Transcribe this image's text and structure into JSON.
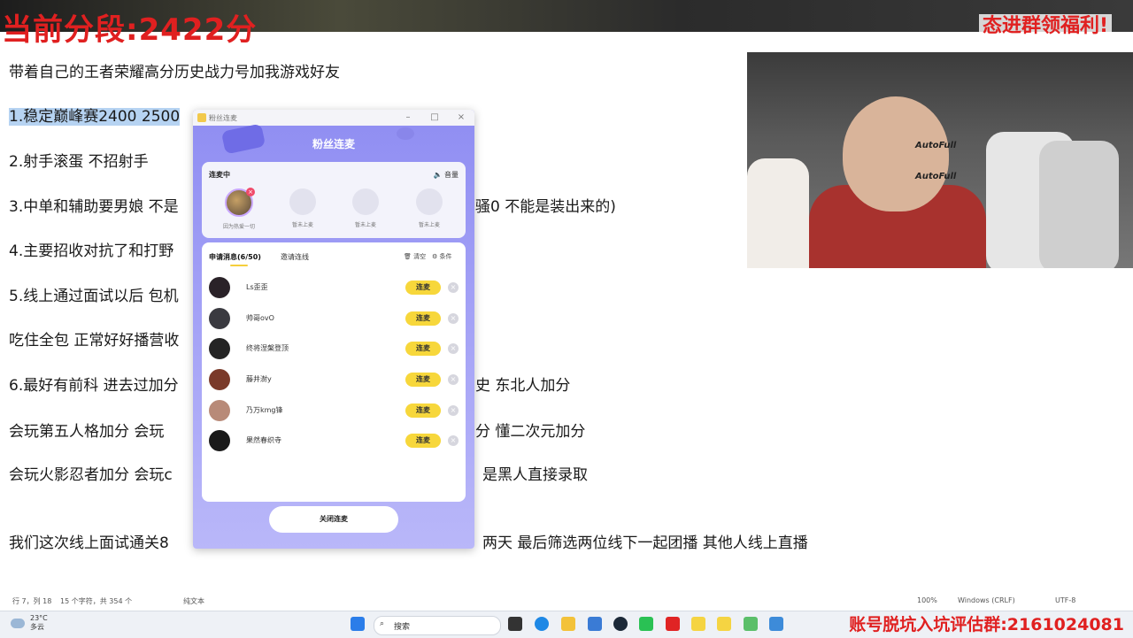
{
  "overlay": {
    "title": "当前分段:2422分",
    "banner": "态进群领福利!"
  },
  "document": {
    "lines": [
      "带着自己的王者荣耀高分历史战力号加我游戏好友",
      "1.稳定巅峰赛2400 2500",
      "2.射手滚蛋 不招射手",
      "3.中单和辅助要男娘 不是",
      "骚0 不能是装出来的)",
      "4.主要招收对抗了和打野",
      "5.线上通过面试以后 包机",
      "吃住全包 正常好好播营收",
      "6.最好有前科 进去过加分",
      "史  东北人加分",
      "会玩第五人格加分 会玩",
      "分 懂二次元加分",
      "会玩火影忍者加分 会玩c",
      "是黑人直接录取",
      "我们这次线上面试通关8",
      "两天 最后筛选两位线下一起团播 其他人线上直播"
    ]
  },
  "statusbar": {
    "position": "行 7，列 18",
    "chars": "15 个字符，共 354 个",
    "format": "纯文本",
    "zoom": "100%",
    "eol": "Windows (CRLF)",
    "encoding": "UTF-8"
  },
  "webcam": {
    "brand1": "AutoFull",
    "brand2": "AutoFull"
  },
  "popup": {
    "window_title": "粉丝连麦",
    "hero_title": "粉丝连麦",
    "live_section": {
      "title": "连麦中",
      "volume": "音量",
      "slots": [
        {
          "label": "因为热爱一切",
          "active": true
        },
        {
          "label": "暂未上麦",
          "active": false
        },
        {
          "label": "暂未上麦",
          "active": false
        },
        {
          "label": "暂未上麦",
          "active": false
        }
      ]
    },
    "requests": {
      "tab_active": "申请消息(6/50)",
      "tab_other": "邀请连线",
      "clear": "清空",
      "conditions": "条件",
      "button_label": "连麦",
      "items": [
        {
          "name": "Ls歪歪",
          "color": "#2a2228"
        },
        {
          "name": "帅哥ovO",
          "color": "#3a3a40"
        },
        {
          "name": "终将涅槃登顶",
          "color": "#242424"
        },
        {
          "name": "藤井澍y",
          "color": "#7a3a2a"
        },
        {
          "name": "乃万kmg锋",
          "color": "#b88a78"
        },
        {
          "name": "果然春织寺",
          "color": "#1a1a1a"
        }
      ]
    },
    "close_button": "关闭连麦"
  },
  "taskbar": {
    "weather_temp": "23°C",
    "weather_desc": "多云",
    "search_placeholder": "搜索",
    "bottom_banner": "账号脱坑入坑评估群:2161024081"
  }
}
